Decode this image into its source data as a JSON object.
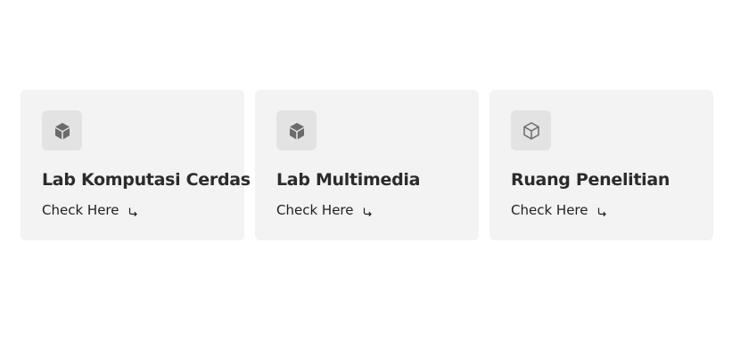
{
  "cards": [
    {
      "title": "Lab Komputasi Cerdas",
      "link_label": "Check Here",
      "icon": "cube-filled-icon"
    },
    {
      "title": "Lab Multimedia",
      "link_label": "Check Here",
      "icon": "cube-filled-icon"
    },
    {
      "title": "Ruang Penelitian",
      "link_label": "Check Here",
      "icon": "cube-outline-icon"
    }
  ],
  "colors": {
    "card_background": "#f3f3f3",
    "icon_box_background": "#e3e3e3",
    "icon_color": "#6b6b6b",
    "title_color": "#2b2b2b"
  }
}
